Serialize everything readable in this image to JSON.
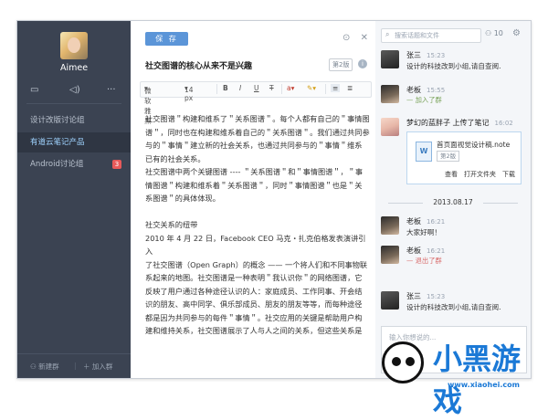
{
  "sidebar": {
    "username": "Aimee",
    "icons": [
      "comment-icon",
      "speaker-icon",
      "more-icon"
    ],
    "groups": [
      {
        "label": "设计改版讨论组",
        "active": false,
        "badge": ""
      },
      {
        "label": "有道云笔记产品",
        "active": true,
        "badge": ""
      },
      {
        "label": "Android讨论组",
        "active": false,
        "badge": "3"
      }
    ],
    "new_group": "新建群",
    "join_group": "加入群"
  },
  "editor": {
    "save_label": "保 存",
    "title": "社交图谱的核心从来不是兴趣",
    "version": "第2版",
    "toolbar": {
      "font": "微软雅黑",
      "size": "14 px",
      "bold": "B",
      "italic": "I",
      "underline": "U",
      "strike": "T"
    },
    "paragraphs": [
      "社交图谱＂构建和维系了＂关系图谱＂。每个人都有自己的＂事情图",
      "谱＂，同时也在构建和维系着自己的＂关系图谱＂。我们通过共同参",
      "与的＂事情＂建立新的社会关系，也通过共同参与的＂事情＂维系",
      "已有的社会关系。",
      "社交图谱中两个关键图谱 ---- ＂关系图谱＂和＂事情图谱＂，＂事",
      "情图谱＂构建和维系着＂关系图谱＂，同时＂事情图谱＂也是＂关",
      "系图谱＂的具体体现。",
      "",
      "社交关系的纽带",
      "2010 年 4 月 22 日，Facebook CEO 马克・扎克伯格发表演讲引入",
      "了社交图谱（Open Graph）的概念 —— 一个将人们和不同事物联",
      "系起来的地图。社交图谱是一种表明＂我认识你＂的网络图谱，它",
      "反映了用户通过各种途径认识的人：家庭成员、工作同事、开会结",
      "识的朋友、高中同学、俱乐部成员、朋友的朋友等等，而每种途径",
      "都是因为共同参与的每件＂事情＂。社交应用的关键是帮助用户构",
      "建和维持关系，社交图谱展示了人与人之间的关系，但这些关系是"
    ]
  },
  "chat": {
    "search_placeholder": "搜索话题和文件",
    "member_count": "10",
    "messages": [
      {
        "name": "张三",
        "time": "15:23",
        "text": "设计的科技改到小组,请自查阅."
      },
      {
        "name": "老板",
        "time": "15:55",
        "system": "加入了群"
      },
      {
        "name": "梦幻的蓝胖子",
        "action": "上传了笔记",
        "time": "16:02"
      },
      {
        "name": "老板",
        "time": "16:21",
        "text": "大家好啊！"
      },
      {
        "name": "老板",
        "time": "16:21",
        "system": "退出了群"
      },
      {
        "name": "张三",
        "time": "15:23",
        "text": "设计的科技改到小组,请自查阅."
      }
    ],
    "file": {
      "name": "首页面视觉设计稿.note",
      "version": "第2版",
      "actions": [
        "查看",
        "打开文件夹",
        "下载"
      ]
    },
    "date_divider": "2013.08.17",
    "input_placeholder": "输入你想说的..."
  },
  "watermark": {
    "brand": "小黑游戏",
    "url": "www.xiaohei.com"
  },
  "colors": {
    "sidebar_bg": "#3b4352",
    "accent": "#5b95d8",
    "active_nav_text": "#9fd3ff",
    "badge": "#e85a5a",
    "join_system": "#7aa35a",
    "leave_system": "#d86b6b"
  }
}
